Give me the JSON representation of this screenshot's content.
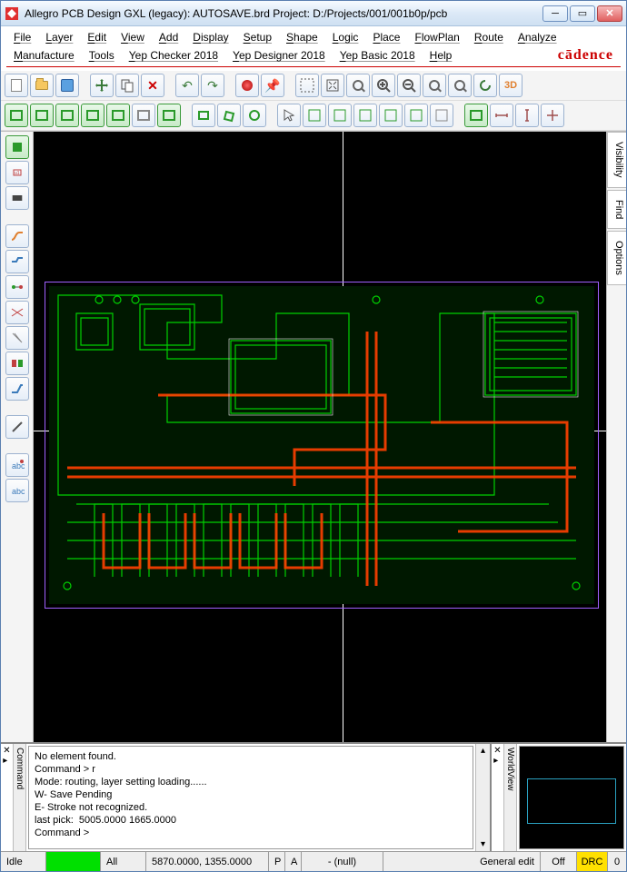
{
  "title": "Allegro PCB Design GXL (legacy): AUTOSAVE.brd  Project: D:/Projects/001/001b0p/pcb",
  "menus": {
    "row1": [
      "File",
      "Layer",
      "Edit",
      "View",
      "Add",
      "Display",
      "Setup",
      "Shape",
      "Logic",
      "Place",
      "FlowPlan",
      "Route",
      "Analyze"
    ],
    "row2": [
      "Manufacture",
      "Tools",
      "Yep Checker 2018",
      "Yep Designer 2018",
      "Yep Basic 2018",
      "Help"
    ]
  },
  "logo": "cādence",
  "right_tabs": [
    "Visibility",
    "Find",
    "Options"
  ],
  "command_panel": {
    "tab": "Command",
    "lines": [
      "No element found.",
      "Command > r",
      "Mode: routing, layer setting loading......",
      "W- Save Pending",
      "E- Stroke not recognized.",
      "last pick:  5005.0000 1665.0000",
      "Command >"
    ]
  },
  "worldview_tab": "WorldView",
  "status": {
    "idle": "Idle",
    "all": "All",
    "coords": "5870.0000, 1355.0000",
    "p": "P",
    "a": "A",
    "null": "- (null)",
    "mode": "General edit",
    "off": "Off",
    "drc": "DRC",
    "zero": "0"
  }
}
